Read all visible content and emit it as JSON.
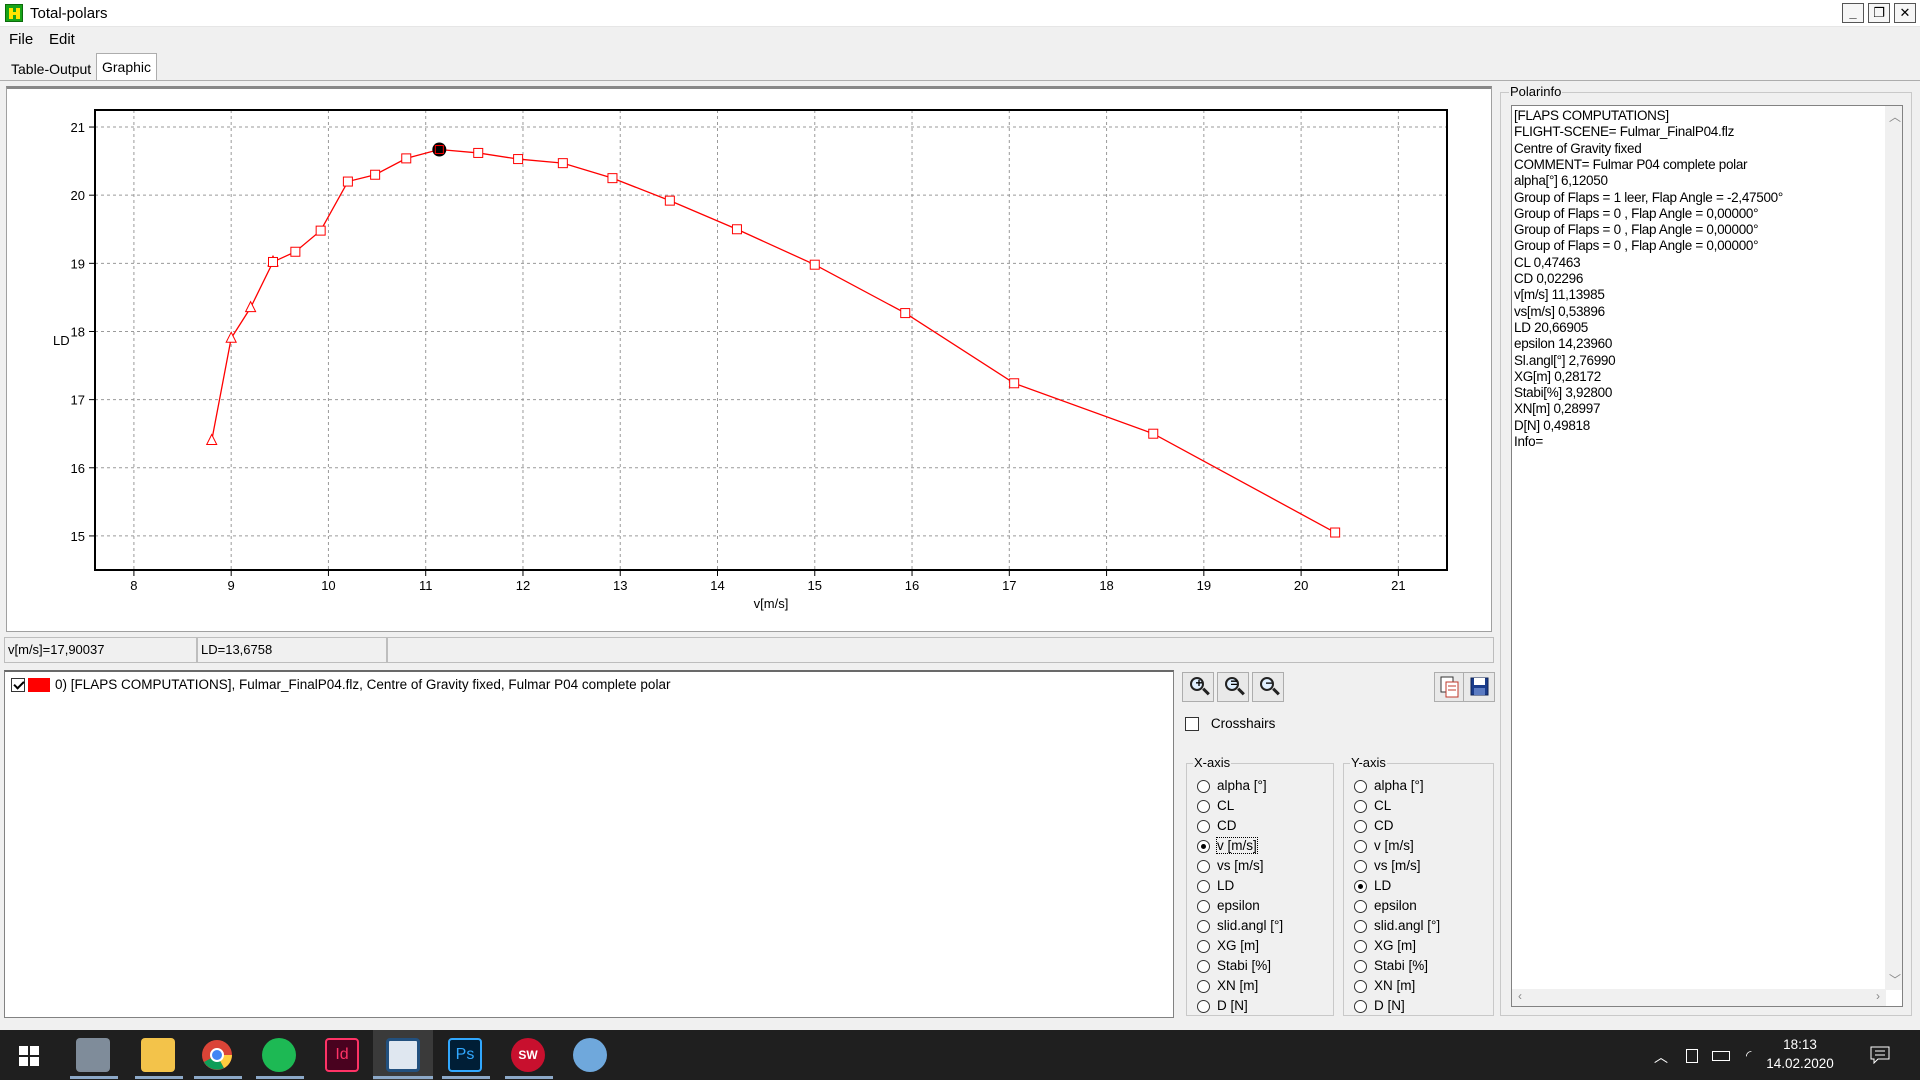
{
  "window": {
    "title": "Total-polars",
    "min_label": "_",
    "max_label": "❐",
    "close_label": "✕"
  },
  "menu": {
    "file": "File",
    "edit": "Edit"
  },
  "tabs": {
    "table_output": "Table-Output",
    "graphic": "Graphic"
  },
  "chart_data": {
    "type": "line",
    "xlabel": "v[m/s]",
    "ylabel": "LD",
    "xlim": [
      7.6,
      21.5
    ],
    "ylim": [
      14.5,
      21.25
    ],
    "xticks": [
      8,
      9,
      10,
      11,
      12,
      13,
      14,
      15,
      16,
      17,
      18,
      19,
      20,
      21
    ],
    "yticks": [
      15,
      16,
      17,
      18,
      19,
      20,
      21
    ],
    "grid": true,
    "color": "#ff0000",
    "series": [
      {
        "marker": "triangle",
        "x": [
          8.8,
          9.0,
          9.2,
          9.43
        ],
        "y": [
          16.4,
          17.9,
          18.35,
          19.02
        ]
      },
      {
        "marker": "square",
        "x": [
          9.43,
          9.66,
          9.92,
          10.2,
          10.48,
          10.8,
          11.14,
          11.54,
          11.95,
          12.41,
          12.92,
          13.51,
          14.2,
          15.0,
          15.93,
          17.05,
          18.48,
          20.35
        ],
        "y": [
          19.02,
          19.17,
          19.48,
          20.2,
          20.3,
          20.54,
          20.67,
          20.62,
          20.53,
          20.47,
          20.25,
          19.92,
          19.5,
          18.98,
          18.27,
          17.24,
          16.5,
          15.05
        ]
      }
    ],
    "highlight": {
      "x": 11.14,
      "y": 20.67
    }
  },
  "status": {
    "v": "v[m/s]=17,90037",
    "ld": "LD=13,6758",
    "extra": ""
  },
  "polar_list": [
    {
      "label": "0) [FLAPS COMPUTATIONS], Fulmar_FinalP04.flz, Centre of Gravity fixed, Fulmar P04 complete polar",
      "checked": true,
      "color": "#ff0000"
    }
  ],
  "tools": {
    "zoom_in": "+",
    "zoom_reset": "=",
    "zoom_out": "−",
    "crosshairs": "Crosshairs"
  },
  "x_axis": {
    "title": "X-axis",
    "options": [
      "alpha [°]",
      "CL",
      "CD",
      "v [m/s]",
      "vs [m/s]",
      "LD",
      "epsilon",
      "slid.angl [°]",
      "XG [m]",
      "Stabi [%]",
      "XN [m]",
      "D [N]"
    ],
    "selected": "v [m/s]"
  },
  "y_axis": {
    "title": "Y-axis",
    "options": [
      "alpha [°]",
      "CL",
      "CD",
      "v [m/s]",
      "vs [m/s]",
      "LD",
      "epsilon",
      "slid.angl [°]",
      "XG [m]",
      "Stabi [%]",
      "XN [m]",
      "D [N]"
    ],
    "selected": "LD"
  },
  "polarinfo": {
    "title": "Polarinfo",
    "lines": [
      "[FLAPS COMPUTATIONS]",
      "FLIGHT-SCENE= Fulmar_FinalP04.flz",
      "Centre of Gravity fixed",
      "COMMENT= Fulmar P04 complete polar",
      "alpha[°] 6,12050",
      "Group of Flaps =  1 leer, Flap Angle =  -2,47500°",
      "Group of Flaps =  0 , Flap Angle =  0,00000°",
      "Group of Flaps =  0 , Flap Angle =  0,00000°",
      "Group of Flaps =  0 , Flap Angle =  0,00000°",
      "CL 0,47463",
      "CD 0,02296",
      "v[m/s] 11,13985",
      "vs[m/s] 0,53896",
      "LD 20,66905",
      "epsilon 14,23960",
      "Sl.angl[°] 2,76990",
      "XG[m] 0,28172",
      "Stabi[%] 3,92800",
      "XN[m] 0,28997",
      "D[N] 0,49818",
      "Info="
    ]
  },
  "taskbar": {
    "time": "18:13",
    "date": "14.02.2020"
  }
}
